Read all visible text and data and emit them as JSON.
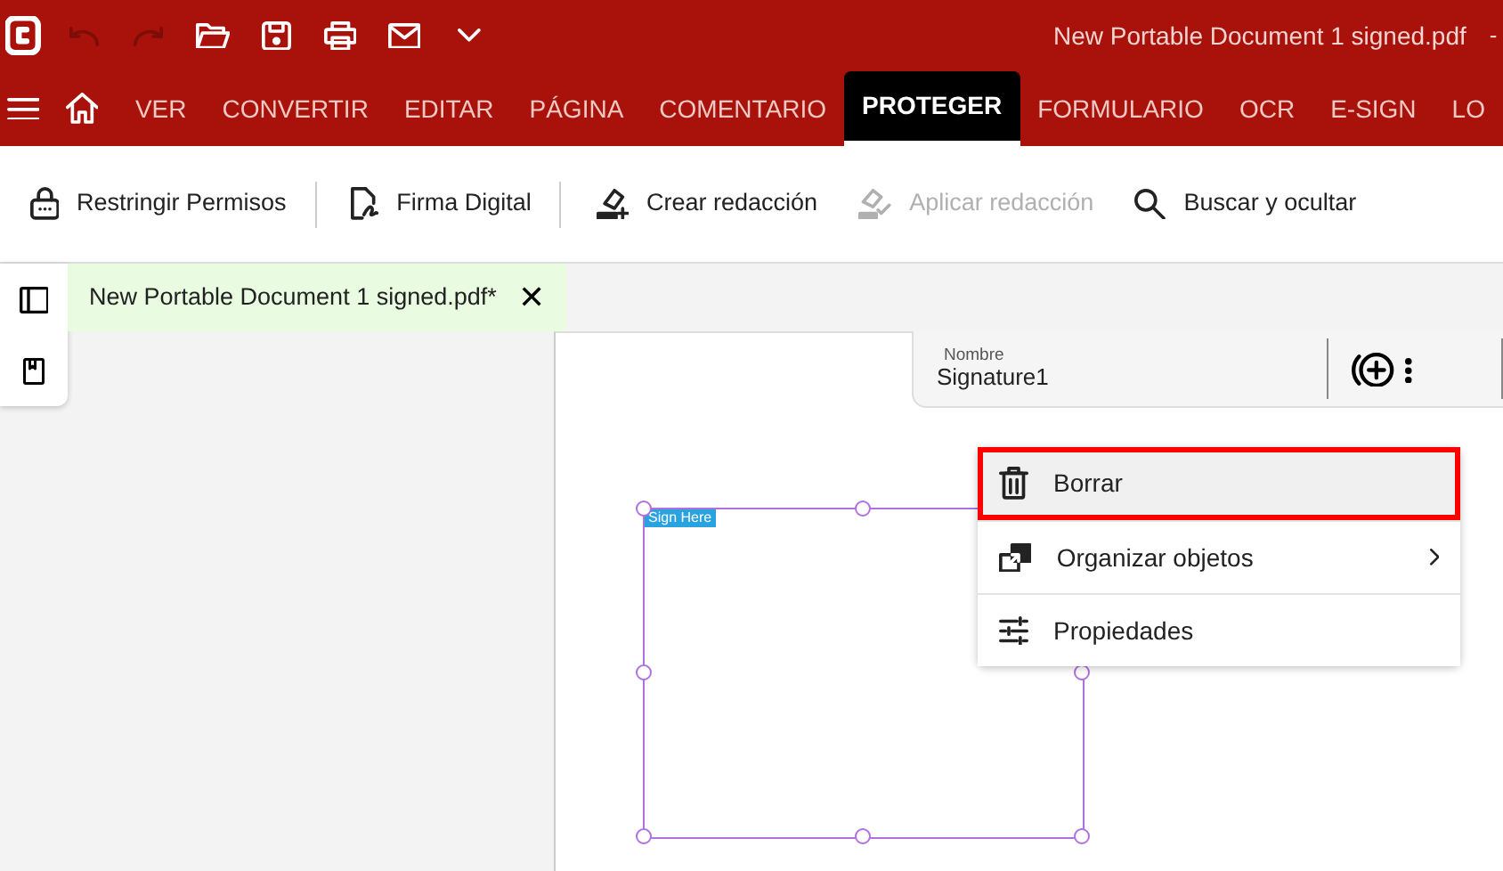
{
  "title_bar": {
    "title": "New Portable Document 1 signed.pdf",
    "suffix": "-"
  },
  "quick_access": [
    {
      "disabled": true
    },
    {
      "disabled": true
    },
    {
      "disabled": false
    },
    {
      "disabled": false
    },
    {
      "disabled": false
    },
    {
      "disabled": false
    },
    {
      "disabled": false
    }
  ],
  "ribbon_tabs": [
    {
      "label": "VER",
      "selected": false
    },
    {
      "label": "CONVERTIR",
      "selected": false
    },
    {
      "label": "EDITAR",
      "selected": false
    },
    {
      "label": "PÁGINA",
      "selected": false
    },
    {
      "label": "COMENTARIO",
      "selected": false
    },
    {
      "label": "PROTEGER",
      "selected": true
    },
    {
      "label": "FORMULARIO",
      "selected": false
    },
    {
      "label": "OCR",
      "selected": false
    },
    {
      "label": "E-SIGN",
      "selected": false
    },
    {
      "label": "LO",
      "selected": false
    }
  ],
  "toolbar": [
    {
      "label": "Restringir Permisos",
      "disabled": false,
      "separator_after": true
    },
    {
      "label": "Firma Digital",
      "disabled": false,
      "separator_after": true
    },
    {
      "label": "Crear redacción",
      "disabled": false,
      "separator_after": false
    },
    {
      "label": "Aplicar redacción",
      "disabled": true,
      "separator_after": false
    },
    {
      "label": "Buscar y ocultar",
      "disabled": false,
      "separator_after": false
    }
  ],
  "document_tab": {
    "label": "New Portable Document 1 signed.pdf*",
    "close": "✕"
  },
  "field_bar": {
    "label": "Nombre",
    "value": "Signature1"
  },
  "signature_field": {
    "tag": "Sign Here"
  },
  "context_menu": [
    {
      "label": "Borrar",
      "selected": true,
      "has_submenu": false
    },
    {
      "label": "Organizar objetos",
      "selected": false,
      "has_submenu": true
    },
    {
      "label": "Propiedades",
      "selected": false,
      "has_submenu": false
    }
  ]
}
